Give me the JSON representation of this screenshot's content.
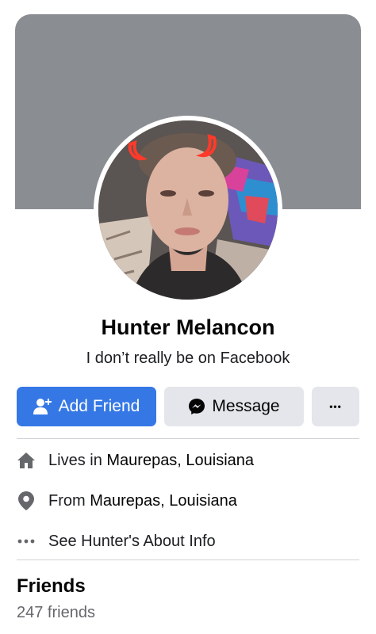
{
  "profile": {
    "name": "Hunter Melancon",
    "bio": "I don’t really be on Facebook"
  },
  "actions": {
    "add_friend": "Add Friend",
    "message": "Message",
    "more": "•••"
  },
  "intro": {
    "lives_prefix": "Lives in ",
    "lives_place": "Maurepas, Louisiana",
    "from_prefix": "From ",
    "from_place": "Maurepas, Louisiana",
    "about_link": "See Hunter's About Info"
  },
  "friends": {
    "title": "Friends",
    "count": "247 friends"
  },
  "icons": {
    "home": "home-icon",
    "location": "location-pin-icon",
    "more": "more-dots-icon",
    "messenger": "messenger-icon",
    "add_person": "add-person-icon"
  },
  "colors": {
    "primary": "#3578e5",
    "secondary_button": "#e4e6eb",
    "cover": "#8a8d91",
    "muted_text": "#65676b"
  }
}
